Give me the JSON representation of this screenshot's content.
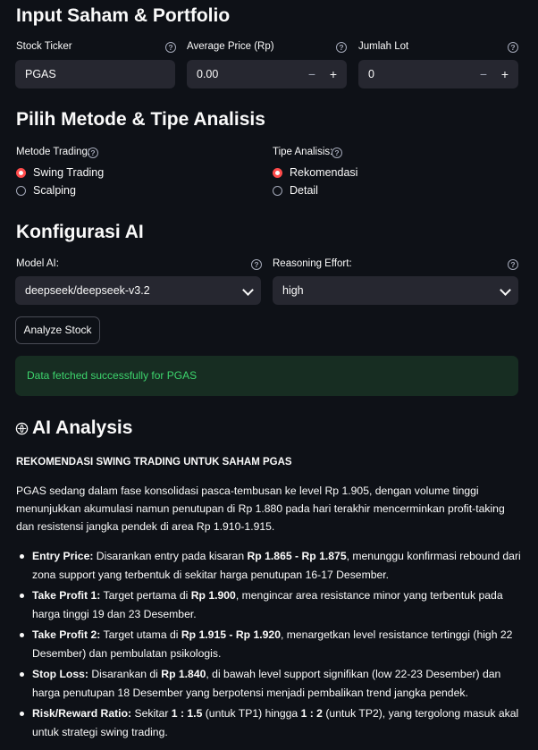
{
  "section_input": {
    "title": "Input Saham & Portfolio",
    "ticker": {
      "label": "Stock Ticker",
      "value": "PGAS"
    },
    "avg_price": {
      "label": "Average Price (Rp)",
      "value": "0.00",
      "minus": "−",
      "plus": "+"
    },
    "lot": {
      "label": "Jumlah Lot",
      "value": "0",
      "minus": "−",
      "plus": "+"
    }
  },
  "section_method": {
    "title": "Pilih Metode & Tipe Analisis",
    "trading": {
      "label": "Metode Trading:",
      "options": [
        "Swing Trading",
        "Scalping"
      ],
      "selected": "Swing Trading"
    },
    "analysis": {
      "label": "Tipe Analisis:",
      "options": [
        "Rekomendasi",
        "Detail"
      ],
      "selected": "Rekomendasi"
    }
  },
  "section_ai": {
    "title": "Konfigurasi AI",
    "model": {
      "label": "Model AI:",
      "value": "deepseek/deepseek-v3.2"
    },
    "effort": {
      "label": "Reasoning Effort:",
      "value": "high"
    }
  },
  "analyze_button": "Analyze Stock",
  "alert_text": "Data fetched successfully for PGAS",
  "result": {
    "title": "AI Analysis",
    "heading": "REKOMENDASI SWING TRADING UNTUK SAHAM PGAS",
    "intro": "PGAS sedang dalam fase konsolidasi pasca-tembusan ke level Rp 1.905, dengan volume tinggi menunjukkan akumulasi namun penutupan di Rp 1.880 pada hari terakhir mencerminkan profit-taking dan resistensi jangka pendek di area Rp 1.910-1.915.",
    "bullets": [
      {
        "key": "Entry Price:",
        "p1": " Disarankan entry pada kisaran ",
        "b1": "Rp 1.865 - Rp 1.875",
        "p2": ", menunggu konfirmasi rebound dari zona support yang terbentuk di sekitar harga penutupan 16-17 Desember."
      },
      {
        "key": "Take Profit 1:",
        "p1": " Target pertama di ",
        "b1": "Rp 1.900",
        "p2": ", mengincar area resistance minor yang terbentuk pada harga tinggi 19 dan 23 Desember."
      },
      {
        "key": "Take Profit 2:",
        "p1": " Target utama di ",
        "b1": "Rp 1.915 - Rp 1.920",
        "p2": ", menargetkan level resistance tertinggi (high 22 Desember) dan pembulatan psikologis."
      },
      {
        "key": "Stop Loss:",
        "p1": " Disarankan di ",
        "b1": "Rp 1.840",
        "p2": ", di bawah level support signifikan (low 22-23 Desember) dan harga penutupan 18 Desember yang berpotensi menjadi pembalikan trend jangka pendek."
      },
      {
        "key": "Risk/Reward Ratio:",
        "p1": " Sekitar ",
        "b1": "1 : 1.5",
        "p2": " (untuk TP1) hingga ",
        "b2": "1 : 2",
        "p3": " (untuk TP2), yang tergolong masuk akal untuk strategi swing trading."
      }
    ]
  }
}
